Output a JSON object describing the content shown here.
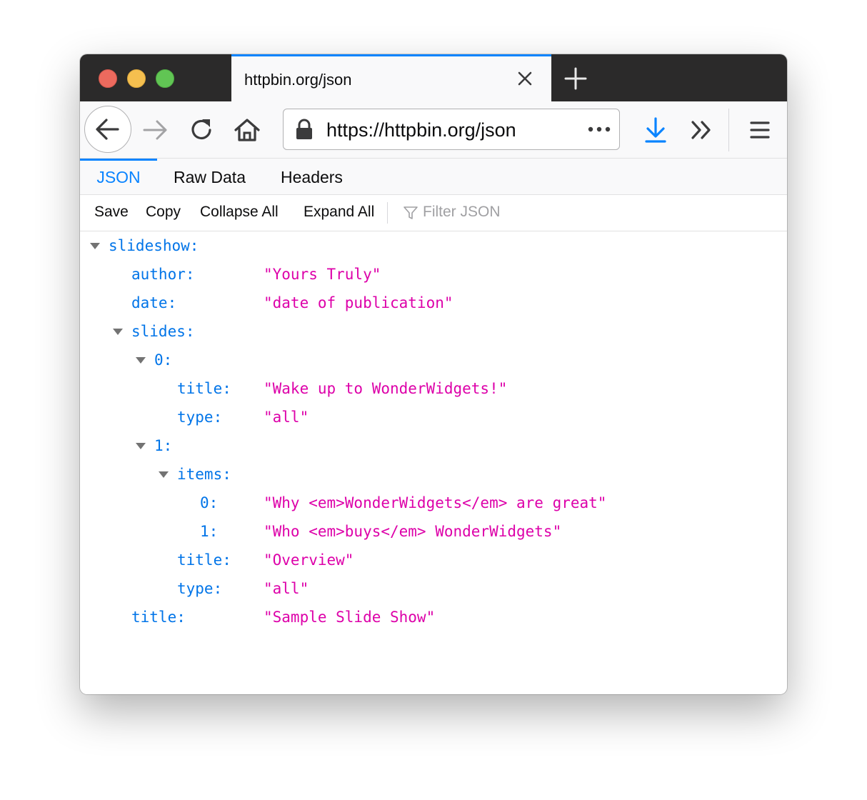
{
  "browser": {
    "tab_title": "httpbin.org/json",
    "url": "https://httpbin.org/json"
  },
  "viewer_tabs": [
    {
      "label": "JSON",
      "active": true
    },
    {
      "label": "Raw Data",
      "active": false
    },
    {
      "label": "Headers",
      "active": false
    }
  ],
  "toolbar": {
    "save": "Save",
    "copy": "Copy",
    "collapse_all": "Collapse All",
    "expand_all": "Expand All",
    "filter_placeholder": "Filter JSON"
  },
  "tree": {
    "slideshow_key": "slideshow:",
    "author_key": "author:",
    "author_val": "\"Yours Truly\"",
    "date_key": "date:",
    "date_val": "\"date of publication\"",
    "slides_key": "slides:",
    "s0_key": "0:",
    "s0_title_key": "title:",
    "s0_title_val": "\"Wake up to WonderWidgets!\"",
    "s0_type_key": "type:",
    "s0_type_val": "\"all\"",
    "s1_key": "1:",
    "items_key": "items:",
    "item0_key": "0:",
    "item0_val": "\"Why <em>WonderWidgets</em> are great\"",
    "item1_key": "1:",
    "item1_val": "\"Who <em>buys</em> WonderWidgets\"",
    "s1_title_key": "title:",
    "s1_title_val": "\"Overview\"",
    "s1_type_key": "type:",
    "s1_type_val": "\"all\"",
    "title_key": "title:",
    "title_val": "\"Sample Slide Show\""
  },
  "colors": {
    "accent": "#0a84ff",
    "json_key": "#0074e8",
    "json_string": "#dd00a9"
  }
}
